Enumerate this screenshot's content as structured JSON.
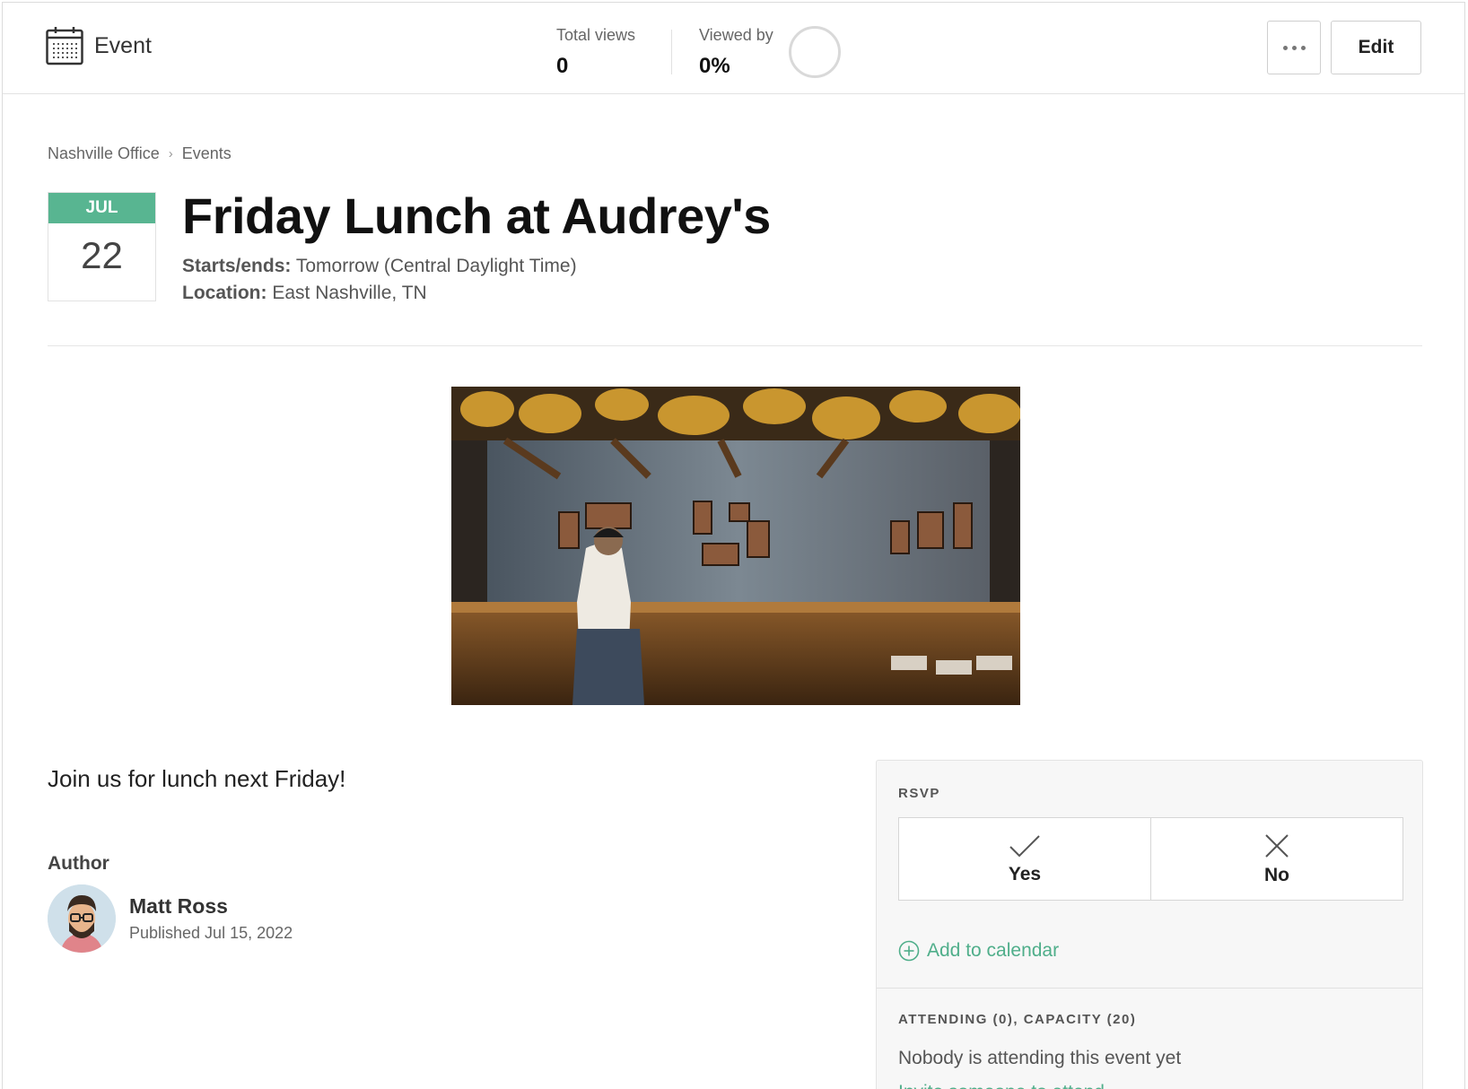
{
  "header": {
    "type_label": "Event",
    "total_views_label": "Total views",
    "total_views_value": "0",
    "viewed_by_label": "Viewed by",
    "viewed_by_value": "0%",
    "viewed_by_fraction": 0,
    "more_button_icon": "more-dots-icon",
    "edit_label": "Edit"
  },
  "breadcrumb": {
    "items": [
      "Nashville Office",
      "Events"
    ]
  },
  "event": {
    "month": "JUL",
    "day": "22",
    "title": "Friday Lunch at Audrey's",
    "starts_label": "Starts/ends:",
    "starts_value": "Tomorrow (Central Daylight Time)",
    "location_label": "Location:",
    "location_value": "East Nashville, TN",
    "description": "Join us for lunch next Friday!"
  },
  "author": {
    "heading": "Author",
    "name": "Matt Ross",
    "published": "Published Jul 15, 2022"
  },
  "rsvp": {
    "heading": "RSVP",
    "yes_label": "Yes",
    "no_label": "No",
    "add_calendar": "Add to calendar",
    "attending_heading": "ATTENDING (0), CAPACITY (20)",
    "empty_text": "Nobody is attending this event yet",
    "invite_link": "Invite someone to attend"
  },
  "colors": {
    "accent": "#58b591",
    "link": "#4fae8a"
  }
}
